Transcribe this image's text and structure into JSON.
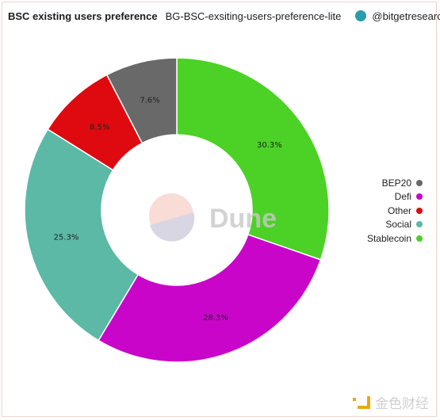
{
  "header": {
    "title": "BSC existing users preference",
    "query_name": "BG-BSC-exsiting-users-preference-lite",
    "author": "@bitgetresearch"
  },
  "watermark": "Dune",
  "footer_brand": "金色财经",
  "chart_data": {
    "type": "pie",
    "donut": true,
    "title": "BSC existing users preference",
    "legend_position": "right",
    "slices": [
      {
        "label": "Stablecoin",
        "value": 30.3,
        "display": "30.3%",
        "color": "#4cd126"
      },
      {
        "label": "Defi",
        "value": 28.3,
        "display": "28.3%",
        "color": "#c905c9"
      },
      {
        "label": "Social",
        "value": 25.3,
        "display": "25.3%",
        "color": "#5bb9a6"
      },
      {
        "label": "Other",
        "value": 8.5,
        "display": "8.5%",
        "color": "#de0a0f"
      },
      {
        "label": "BEP20",
        "value": 7.6,
        "display": "7.6%",
        "color": "#696969"
      }
    ],
    "legend": [
      {
        "label": "BEP20",
        "color": "#696969"
      },
      {
        "label": "Defi",
        "color": "#c905c9"
      },
      {
        "label": "Other",
        "color": "#de0a0f"
      },
      {
        "label": "Social",
        "color": "#5bb9a6"
      },
      {
        "label": "Stablecoin",
        "color": "#4cd126"
      }
    ]
  }
}
